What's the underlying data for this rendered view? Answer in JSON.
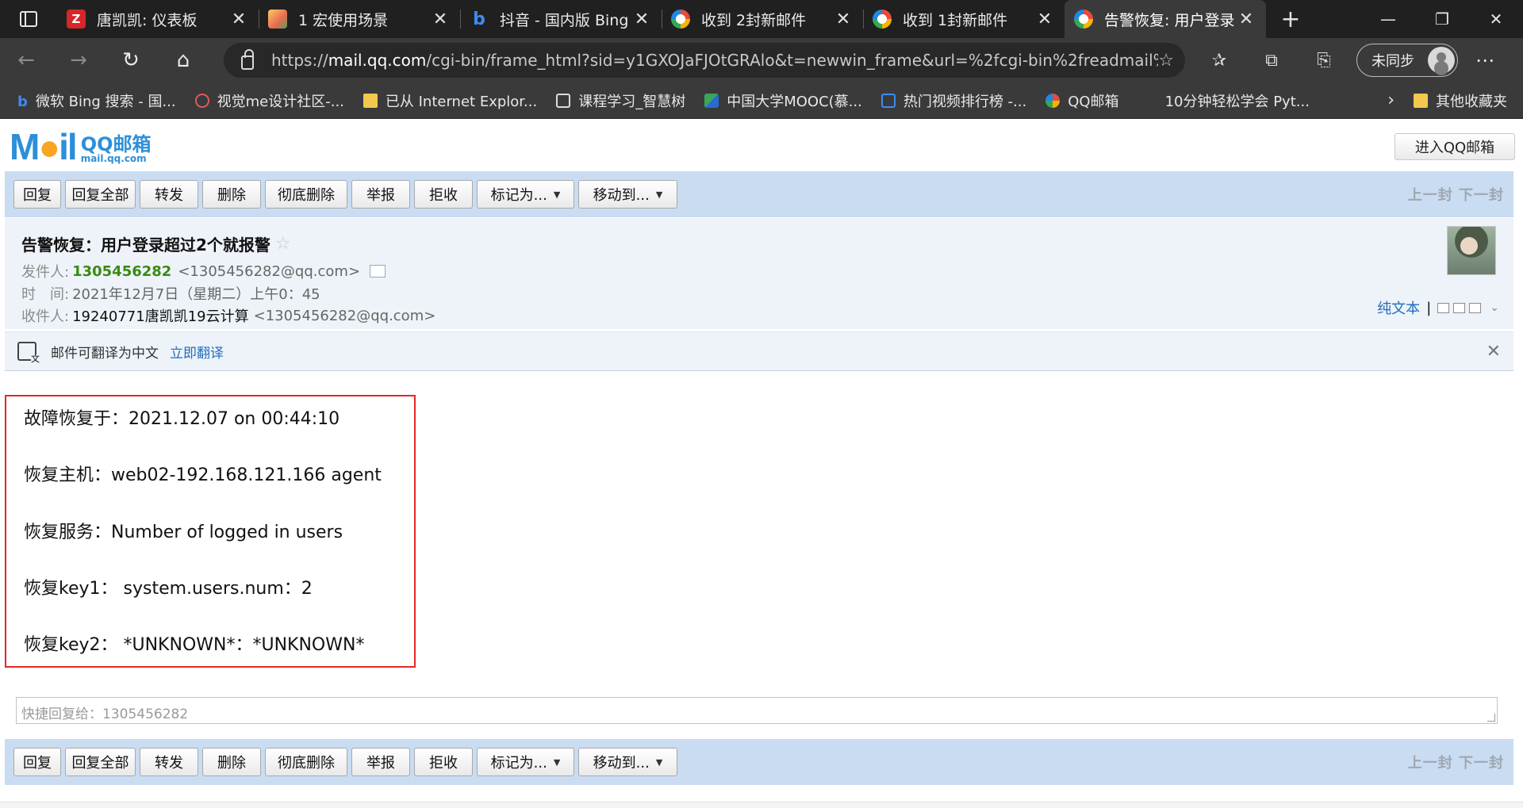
{
  "browser": {
    "tabs": [
      {
        "title": "唐凯凯: 仪表板",
        "icon": "z-icon"
      },
      {
        "title": "1 宏使用场景",
        "icon": "image-icon"
      },
      {
        "title": "抖音 - 国内版 Bing",
        "icon": "bing-icon"
      },
      {
        "title": "收到 2封新邮件",
        "icon": "qq-mail-icon"
      },
      {
        "title": "收到 1封新邮件",
        "icon": "qq-mail-icon"
      },
      {
        "title": "告警恢复: 用户登录",
        "icon": "qq-mail-icon",
        "active": true
      }
    ],
    "url_prefix": "https://",
    "url_host": "mail.qq.com",
    "url_path": "/cgi-bin/frame_html?sid=y1GXOJaFJOtGRAlo&t=newwin_frame&url=%2fcgi-bin%2freadmail%...",
    "sync_label": "未同步",
    "favorites": [
      {
        "label": "微软 Bing 搜索 - 国...",
        "icon": "bing-icon"
      },
      {
        "label": "视觉me设计社区-...",
        "icon": "eye-icon"
      },
      {
        "label": "已从 Internet Explor...",
        "icon": "folder-icon"
      },
      {
        "label": "课程学习_智慧树",
        "icon": "document-icon"
      },
      {
        "label": "中国大学MOOC(慕...",
        "icon": "mooc-icon"
      },
      {
        "label": "热门视频排行榜 -...",
        "icon": "tv-icon"
      },
      {
        "label": "QQ邮箱",
        "icon": "qq-mail-icon"
      },
      {
        "label": "10分钟轻松学会 Pyt...",
        "icon": ""
      }
    ],
    "other_favorites": "其他收藏夹"
  },
  "mail": {
    "logo_main": "M",
    "logo_o": "●",
    "logo_rest": "il",
    "logo_cn": "QQ邮箱",
    "logo_en": "mail.qq.com",
    "enter_button": "进入QQ邮箱",
    "toolbar": {
      "reply": "回复",
      "reply_all": "回复全部",
      "forward": "转发",
      "delete": "删除",
      "delete_forever": "彻底删除",
      "report": "举报",
      "reject": "拒收",
      "mark_as": "标记为...",
      "move_to": "移动到...",
      "prev_next": "上一封 下一封"
    },
    "subject": "告警恢复：用户登录超过2个就报警",
    "from_label": "发件人:",
    "from_name": "1305456282",
    "from_addr": "<1305456282@qq.com>",
    "time_label": "时　间:",
    "time_value": "2021年12月7日（星期二）上午0：45",
    "to_label": "收件人:",
    "to_name": "19240771唐凯凯19云计算",
    "to_addr": "<1305456282@qq.com>",
    "plain_text": "纯文本",
    "translate_text": "邮件可翻译为中文",
    "translate_link": "立即翻译",
    "body_lines": [
      "故障恢复于：2021.12.07 on 00:44:10",
      "恢复主机：web02-192.168.121.166 agent",
      "恢复服务：Number of logged in users",
      "恢复key1： system.users.num：2",
      "恢复key2： *UNKNOWN*：*UNKNOWN*"
    ],
    "quick_reply_placeholder": "快捷回复给：1305456282"
  }
}
